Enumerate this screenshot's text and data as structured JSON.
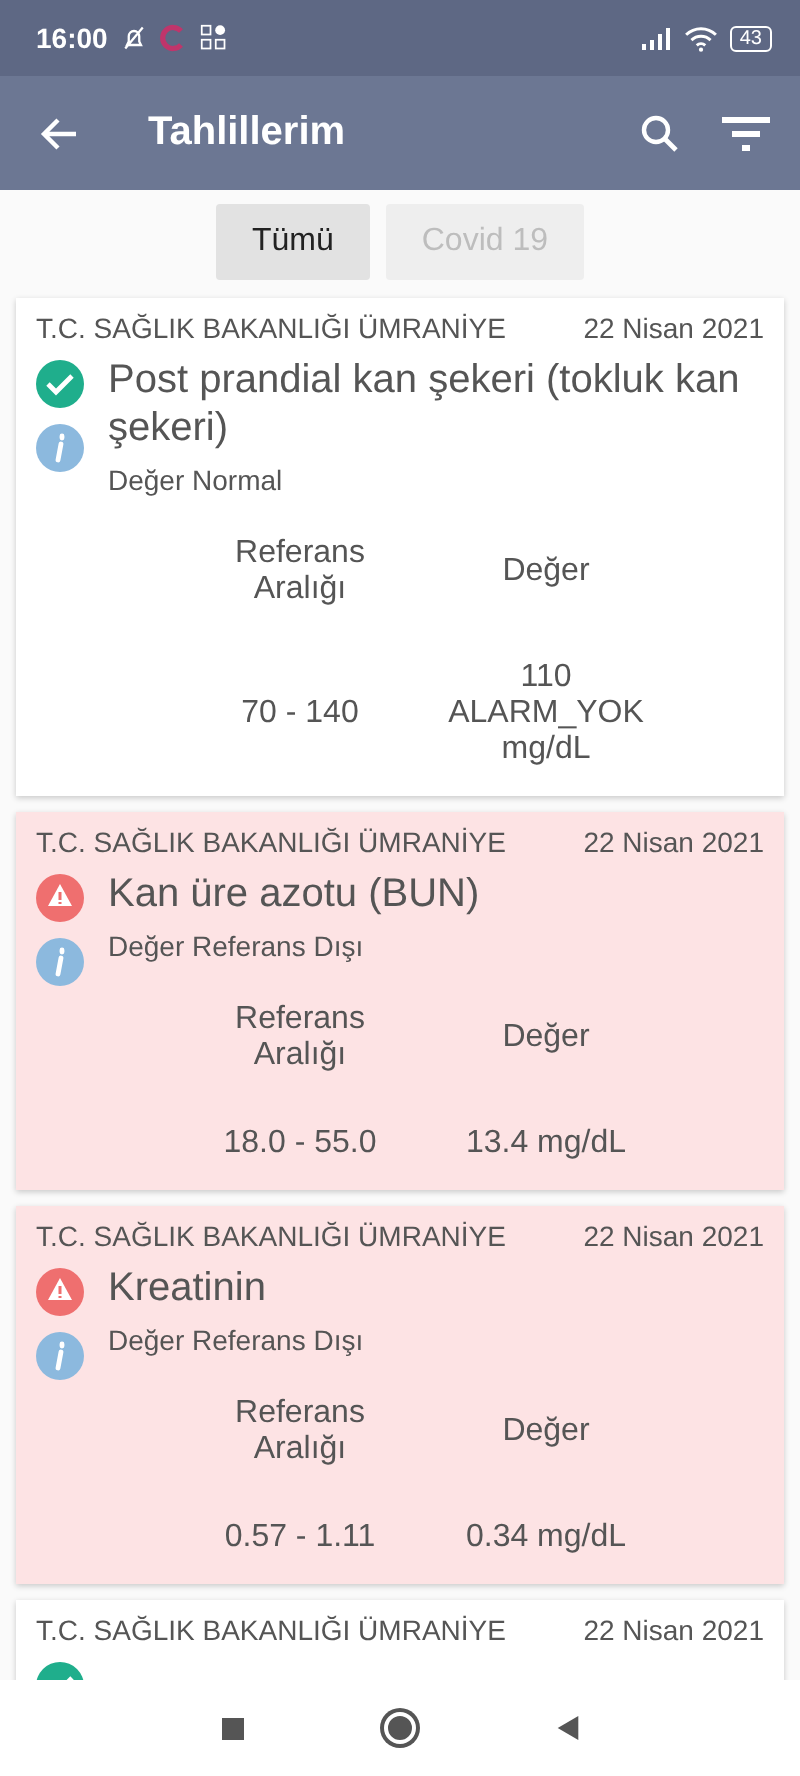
{
  "status_bar": {
    "time": "16:00",
    "battery": "43"
  },
  "app_bar": {
    "title": "Tahlillerim"
  },
  "filters": [
    {
      "label": "Tümü",
      "selected": true
    },
    {
      "label": "Covid 19",
      "selected": false
    }
  ],
  "results": [
    {
      "institution": "T.C. SAĞLIK BAKANLIĞI ÜMRANİYE",
      "date": "22 Nisan 2021",
      "out_of_range": false,
      "title": "Post prandial kan şekeri (tokluk kan şekeri)",
      "note": "Değer Normal",
      "range_heading": "Referans Aralığı",
      "value_heading": "Değer",
      "range": "70 - 140",
      "value": "110 ALARM_YOK mg/dL"
    },
    {
      "institution": "T.C. SAĞLIK BAKANLIĞI ÜMRANİYE",
      "date": "22 Nisan 2021",
      "out_of_range": true,
      "title": "Kan üre azotu (BUN)",
      "note": "Değer Referans Dışı",
      "range_heading": "Referans Aralığı",
      "value_heading": "Değer",
      "range": "18.0 - 55.0",
      "value": "13.4 mg/dL"
    },
    {
      "institution": "T.C. SAĞLIK BAKANLIĞI ÜMRANİYE",
      "date": "22 Nisan 2021",
      "out_of_range": true,
      "title": "Kreatinin",
      "note": "Değer Referans Dışı",
      "range_heading": "Referans Aralığı",
      "value_heading": "Değer",
      "range": "0.57 - 1.11",
      "value": "0.34 mg/dL"
    },
    {
      "institution": "T.C. SAĞLIK BAKANLIĞI ÜMRANİYE",
      "date": "22 Nisan 2021",
      "out_of_range": false
    }
  ]
}
